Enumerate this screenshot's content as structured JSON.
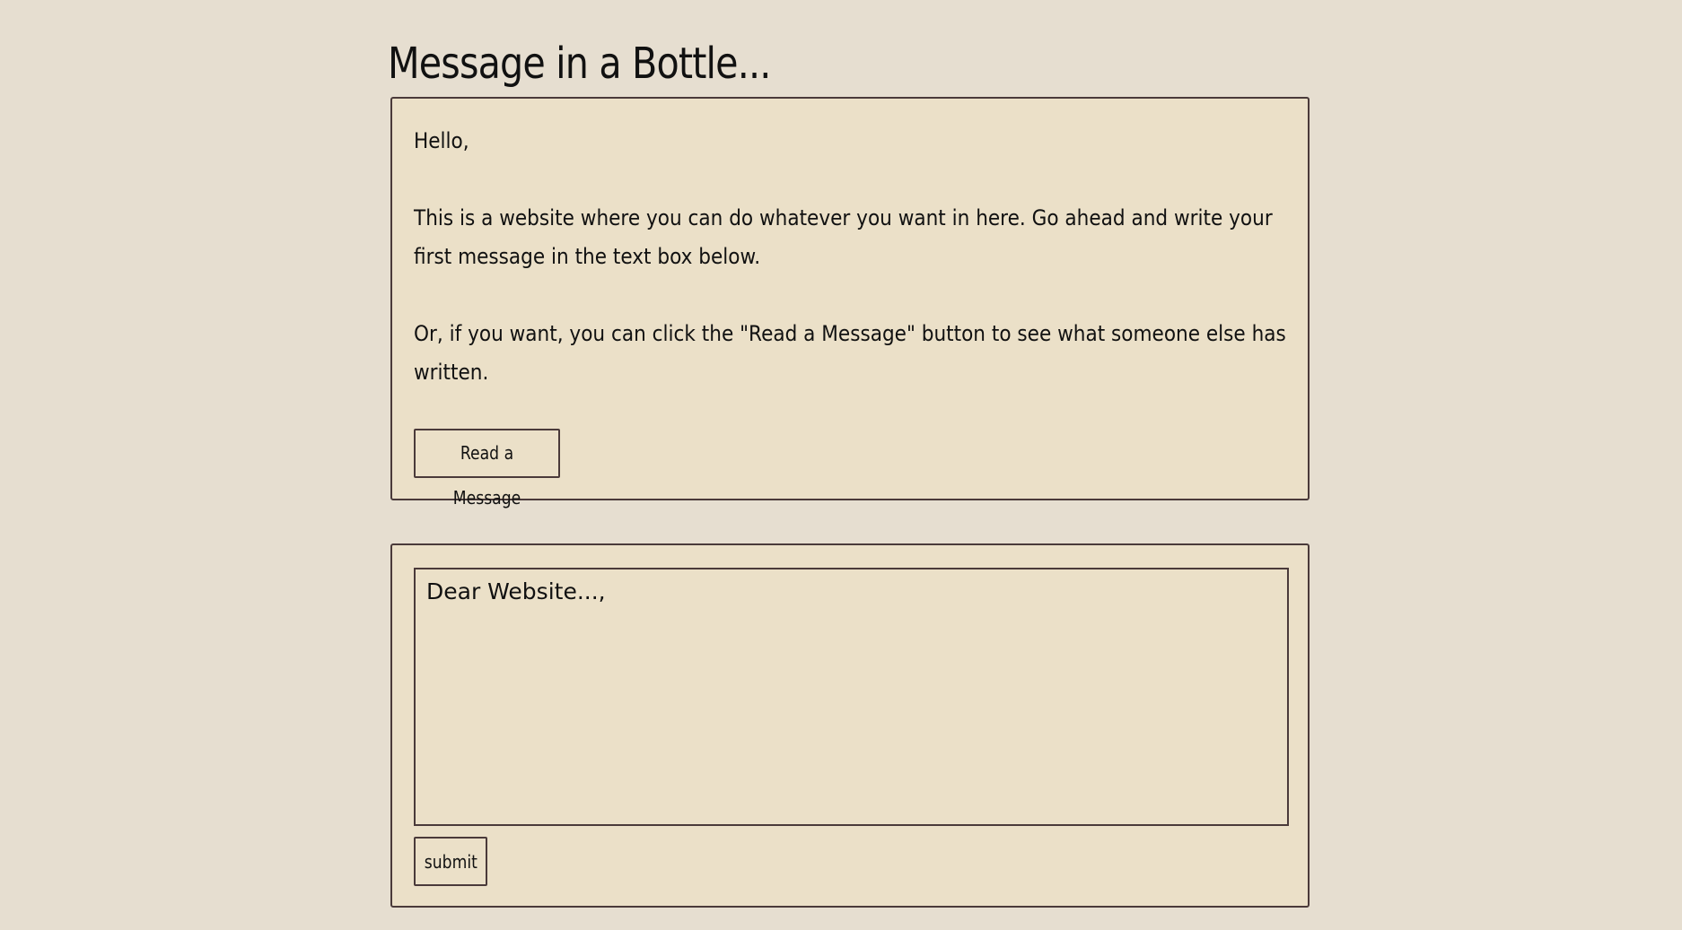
{
  "header": {
    "title": "Message in a Bottle..."
  },
  "intro": {
    "greeting": "Hello,",
    "paragraph1": "This is a website where you can do whatever you want in here. Go ahead and write your first message in the text box below.",
    "paragraph2": "Or, if you want, you can click the \"Read a Message\" button to see what someone else has written.",
    "read_button_label": "Read a Message"
  },
  "compose": {
    "placeholder": "Dear Website...,",
    "value": "",
    "submit_label": "submit"
  },
  "colors": {
    "background": "#e6ded0",
    "panel": "#ebe0c8",
    "border": "#4a3a3a",
    "text": "#111111"
  }
}
